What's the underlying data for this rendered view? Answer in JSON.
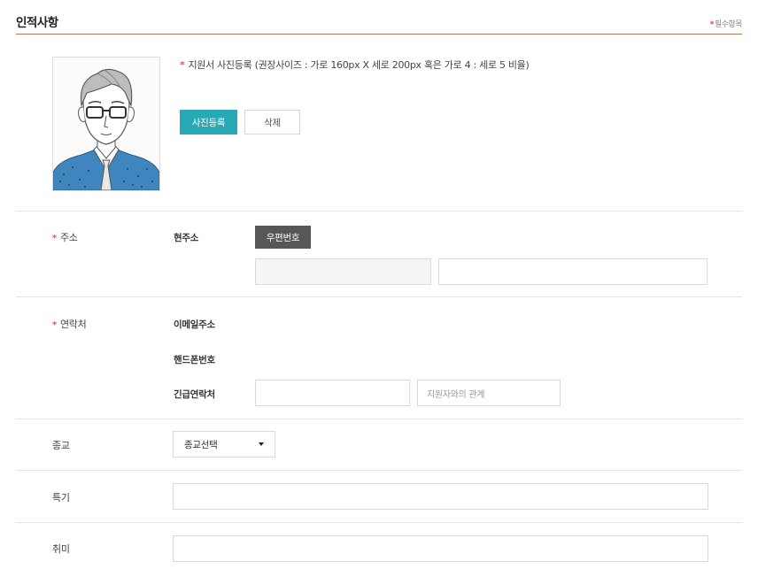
{
  "section": {
    "title": "인적사항",
    "required_mark": "*",
    "required_note": "필수항목"
  },
  "photo": {
    "required_mark": "*",
    "note": "지원서 사진등록 (권장사이즈 : 가로 160px X 세로 200px 혹은 가로 4 : 세로 5 비율)",
    "upload_label": "사진등록",
    "delete_label": "삭제"
  },
  "address": {
    "required_mark": "*",
    "label": "주소",
    "sublabel": "현주소",
    "zip_button": "우편번호",
    "zip_value": "",
    "detail_value": ""
  },
  "contact": {
    "required_mark": "*",
    "label": "연락처",
    "email_label": "이메일주소",
    "phone_label": "핸드폰번호",
    "emergency_label": "긴급연락처",
    "emergency_value": "",
    "relation_placeholder": "지원자와의 관계"
  },
  "religion": {
    "label": "종교",
    "selected": "종교선택"
  },
  "skill": {
    "label": "특기",
    "value": ""
  },
  "hobby": {
    "label": "취미",
    "value": ""
  },
  "colors": {
    "accent": "#27aab5",
    "title_rule": "#b8764f",
    "required": "#e05a52",
    "dark_button": "#575757"
  }
}
